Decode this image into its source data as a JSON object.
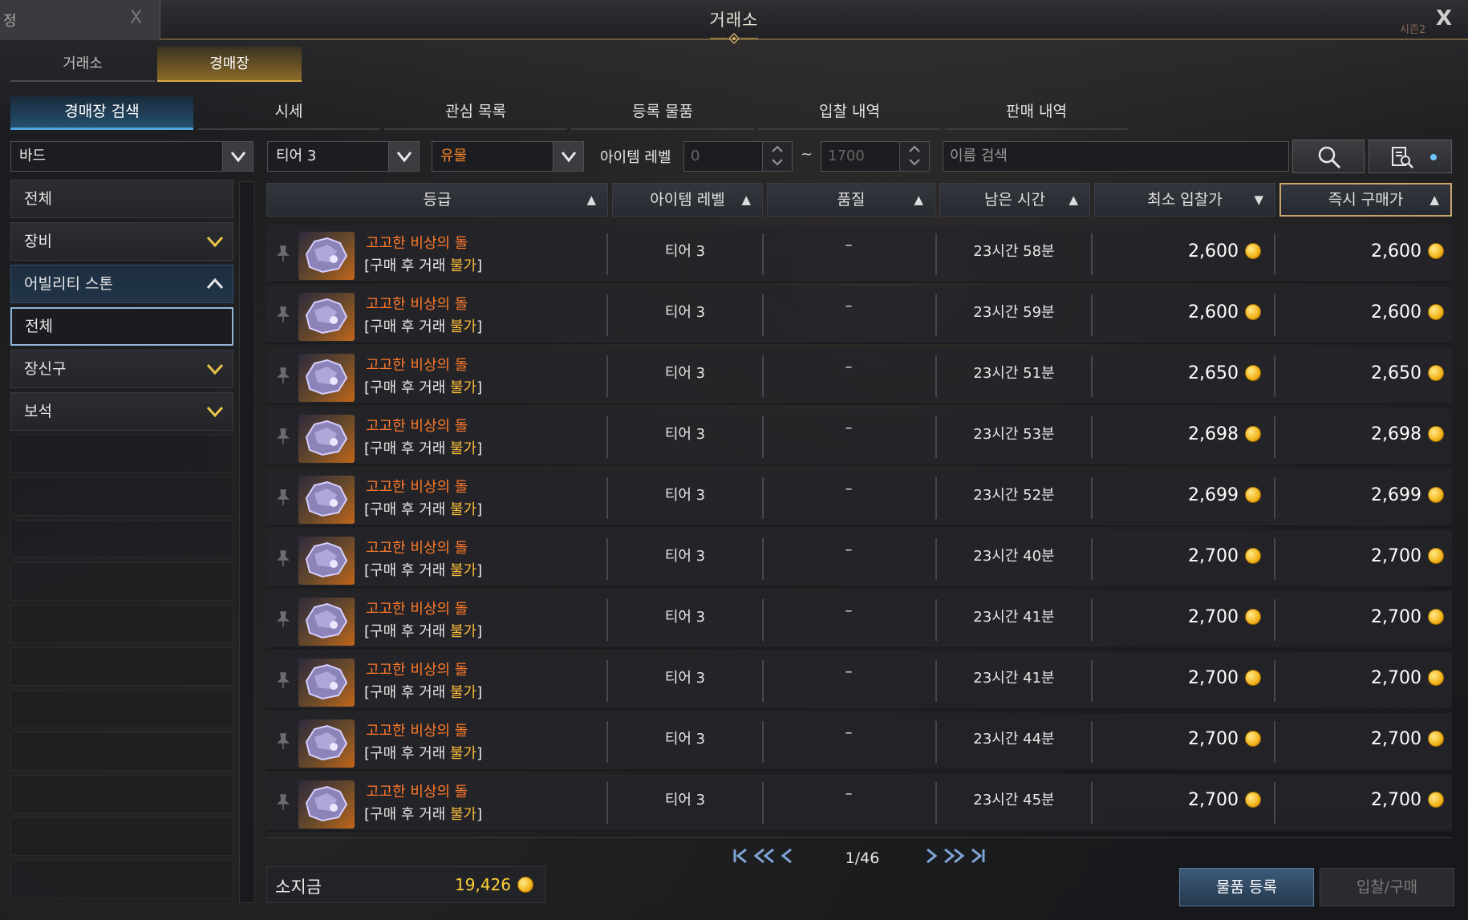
{
  "window": {
    "title": "거래소",
    "prev_window_label": "정",
    "prev_window_close": "X",
    "close_glyph": "X",
    "season_label": "시즌2"
  },
  "top_tabs": [
    {
      "label": "거래소",
      "active": false
    },
    {
      "label": "경매장",
      "active": true
    }
  ],
  "sub_tabs": [
    {
      "label": "경매장 검색",
      "active": true
    },
    {
      "label": "시세",
      "active": false
    },
    {
      "label": "관심 목록",
      "active": false
    },
    {
      "label": "등록 물품",
      "active": false
    },
    {
      "label": "입찰 내역",
      "active": false
    },
    {
      "label": "판매 내역",
      "active": false
    }
  ],
  "filters": {
    "class": "바드",
    "tier": "티어 3",
    "grade": "유물",
    "item_level_label": "아이템 레벨",
    "item_level_min_placeholder": "0",
    "item_level_sep": "~",
    "item_level_max_placeholder": "1700",
    "name_search_placeholder": "이름 검색"
  },
  "sidebar": {
    "items": [
      {
        "label": "전체",
        "state": "normal",
        "chevron": ""
      },
      {
        "label": "장비",
        "state": "normal",
        "chevron": "down"
      },
      {
        "label": "어빌리티 스톤",
        "state": "expanded",
        "chevron": "up"
      },
      {
        "label": "전체",
        "state": "selected",
        "chevron": ""
      },
      {
        "label": "장신구",
        "state": "normal",
        "chevron": "down"
      },
      {
        "label": "보석",
        "state": "normal",
        "chevron": "down"
      }
    ]
  },
  "table": {
    "headers": [
      {
        "label": "등급",
        "sort": "▲",
        "active": false
      },
      {
        "label": "아이템 레벨",
        "sort": "▲",
        "active": false
      },
      {
        "label": "품질",
        "sort": "▲",
        "active": false
      },
      {
        "label": "남은 시간",
        "sort": "▲",
        "active": false
      },
      {
        "label": "최소 입찰가",
        "sort": "▼",
        "active": false
      },
      {
        "label": "즉시 구매가",
        "sort": "▲",
        "active": true
      }
    ],
    "rows": [
      {
        "name": "고고한 비상의 돌",
        "sub_prefix": "[구매 후 거래 ",
        "sub_warn": "불가",
        "sub_suffix": "]",
        "level": "티어 3",
        "quality": "–",
        "time": "23시간 58분",
        "min_bid": "2,600",
        "buyout": "2,600"
      },
      {
        "name": "고고한 비상의 돌",
        "sub_prefix": "[구매 후 거래 ",
        "sub_warn": "불가",
        "sub_suffix": "]",
        "level": "티어 3",
        "quality": "–",
        "time": "23시간 59분",
        "min_bid": "2,600",
        "buyout": "2,600"
      },
      {
        "name": "고고한 비상의 돌",
        "sub_prefix": "[구매 후 거래 ",
        "sub_warn": "불가",
        "sub_suffix": "]",
        "level": "티어 3",
        "quality": "–",
        "time": "23시간 51분",
        "min_bid": "2,650",
        "buyout": "2,650"
      },
      {
        "name": "고고한 비상의 돌",
        "sub_prefix": "[구매 후 거래 ",
        "sub_warn": "불가",
        "sub_suffix": "]",
        "level": "티어 3",
        "quality": "–",
        "time": "23시간 53분",
        "min_bid": "2,698",
        "buyout": "2,698"
      },
      {
        "name": "고고한 비상의 돌",
        "sub_prefix": "[구매 후 거래 ",
        "sub_warn": "불가",
        "sub_suffix": "]",
        "level": "티어 3",
        "quality": "–",
        "time": "23시간 52분",
        "min_bid": "2,699",
        "buyout": "2,699"
      },
      {
        "name": "고고한 비상의 돌",
        "sub_prefix": "[구매 후 거래 ",
        "sub_warn": "불가",
        "sub_suffix": "]",
        "level": "티어 3",
        "quality": "–",
        "time": "23시간 40분",
        "min_bid": "2,700",
        "buyout": "2,700"
      },
      {
        "name": "고고한 비상의 돌",
        "sub_prefix": "[구매 후 거래 ",
        "sub_warn": "불가",
        "sub_suffix": "]",
        "level": "티어 3",
        "quality": "–",
        "time": "23시간 41분",
        "min_bid": "2,700",
        "buyout": "2,700"
      },
      {
        "name": "고고한 비상의 돌",
        "sub_prefix": "[구매 후 거래 ",
        "sub_warn": "불가",
        "sub_suffix": "]",
        "level": "티어 3",
        "quality": "–",
        "time": "23시간 41분",
        "min_bid": "2,700",
        "buyout": "2,700"
      },
      {
        "name": "고고한 비상의 돌",
        "sub_prefix": "[구매 후 거래 ",
        "sub_warn": "불가",
        "sub_suffix": "]",
        "level": "티어 3",
        "quality": "–",
        "time": "23시간 44분",
        "min_bid": "2,700",
        "buyout": "2,700"
      },
      {
        "name": "고고한 비상의 돌",
        "sub_prefix": "[구매 후 거래 ",
        "sub_warn": "불가",
        "sub_suffix": "]",
        "level": "티어 3",
        "quality": "–",
        "time": "23시간 45분",
        "min_bid": "2,700",
        "buyout": "2,700"
      }
    ]
  },
  "footer": {
    "money_label": "소지금",
    "money_value": "19,426",
    "page_text": "1/46",
    "register_button": "물품 등록",
    "bid_buy_button": "입찰/구매"
  },
  "colors": {
    "relic_orange": "#ff7a2a",
    "warning_yellow": "#ffbf3a",
    "accent_blue": "#4fa6e0",
    "gold": "#f3b51c"
  }
}
